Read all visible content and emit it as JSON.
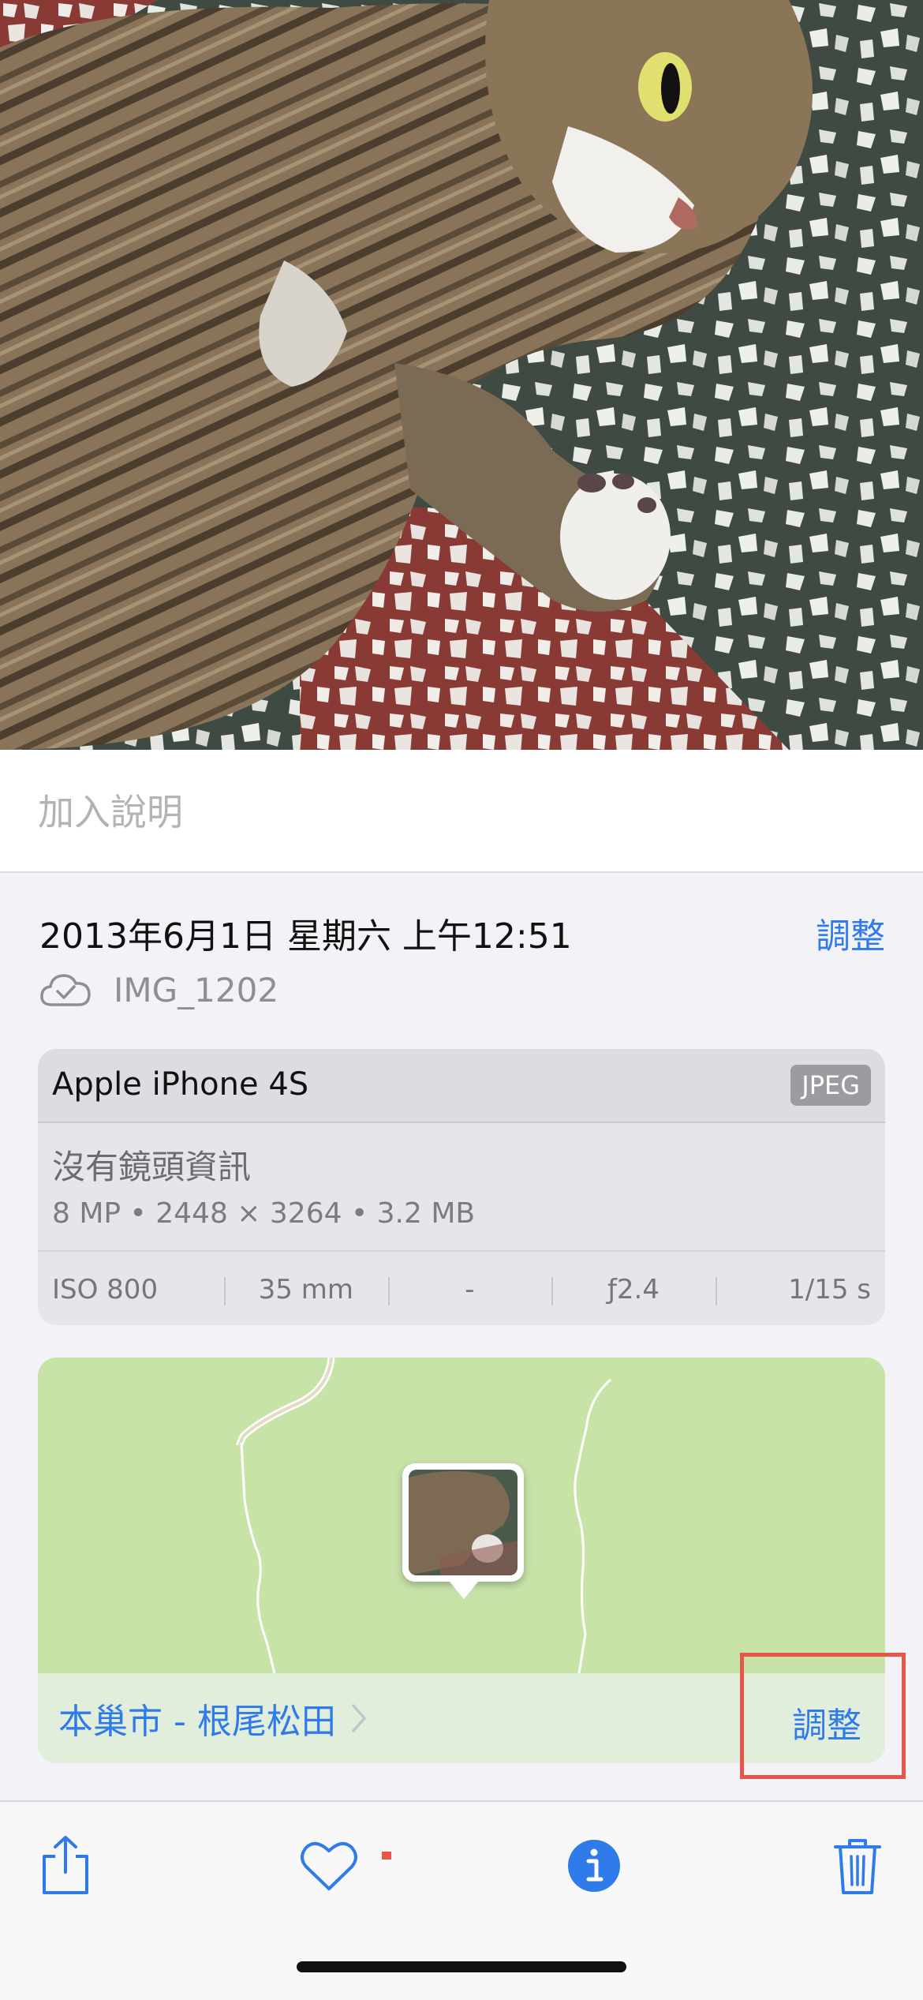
{
  "photo": {
    "subject": "tabby cat lying on terrazzo floor"
  },
  "caption": {
    "placeholder": "加入說明"
  },
  "info": {
    "datetime": "2013年6月1日 星期六 上午12:51",
    "adjust_label": "調整",
    "filename": "IMG_1202",
    "cloud_icon": "cloud-check-icon"
  },
  "camera": {
    "model": "Apple iPhone 4S",
    "format_badge": "JPEG",
    "lens": "沒有鏡頭資訊",
    "specs": "8 MP • 2448 × 3264 • 3.2 MB",
    "exif": [
      "ISO 800",
      "35 mm",
      "-",
      "ƒ2.4",
      "1/15 s"
    ]
  },
  "map": {
    "location": "本巢市 - 根尾松田",
    "adjust_label": "調整",
    "colors": {
      "land": "#c7e3a8",
      "footer": "#e1eedb",
      "road": "#ffffff"
    }
  },
  "toolbar": {
    "icons": [
      "share-icon",
      "heart-icon",
      "info-icon",
      "trash-icon"
    ]
  },
  "colors": {
    "accent": "#2f7bea",
    "highlight": "#e6574a"
  }
}
